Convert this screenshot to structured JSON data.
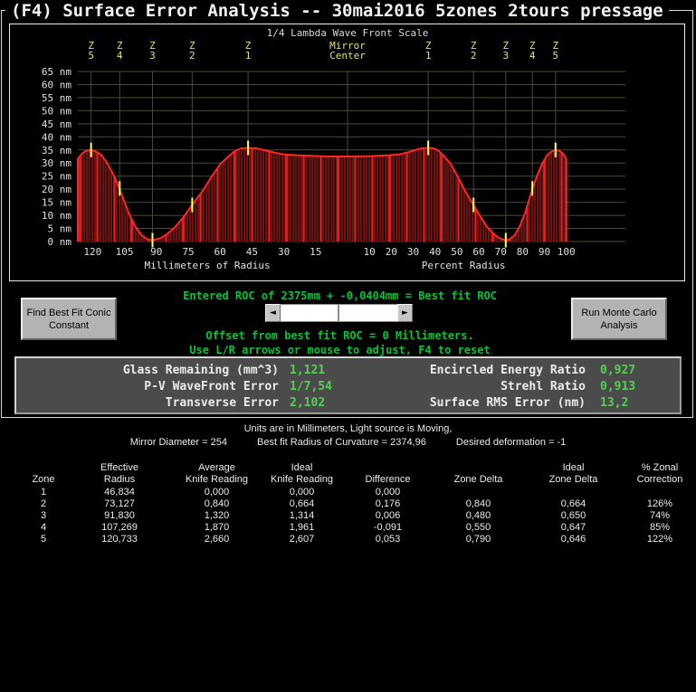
{
  "window": {
    "title": "(F4) Surface Error Analysis -- 30mai2016  5zones 2tours pressage"
  },
  "colors": {
    "accent_green": "#00c838",
    "value_green": "#55d055",
    "zone_yellow": "#e4e45c",
    "curve_red": "#ff2626",
    "hatch_red": "#b01212",
    "grid_olive": "#4a4a39"
  },
  "chart_data": {
    "type": "area",
    "title": "1/4 Lambda Wave Front Scale",
    "y_unit": "nm",
    "ylim": [
      0,
      65
    ],
    "y_ticks": [
      0,
      5,
      10,
      15,
      20,
      25,
      30,
      35,
      40,
      45,
      50,
      55,
      60,
      65
    ],
    "x_left": {
      "label": "Millimeters of Radius",
      "ticks": [
        120,
        105,
        90,
        75,
        60,
        45,
        30,
        15
      ]
    },
    "x_right": {
      "label": "Percent Radius",
      "ticks": [
        10,
        20,
        30,
        40,
        50,
        60,
        70,
        80,
        90,
        100
      ]
    },
    "mirror_radius_mm": 127,
    "center_label": [
      "Mirror",
      "Center"
    ],
    "zones": {
      "numbers": [
        1,
        2,
        3,
        4,
        5
      ],
      "radii_mm": [
        46.834,
        73.127,
        91.83,
        107.269,
        120.733
      ],
      "marker_nm": [
        35.8,
        14,
        0.5,
        20.3,
        35
      ]
    },
    "profile_mm_nm": [
      [
        0,
        32.5
      ],
      [
        8,
        32.5
      ],
      [
        16,
        32.7
      ],
      [
        24,
        33.0
      ],
      [
        30,
        33.3
      ],
      [
        35,
        34.1
      ],
      [
        40,
        35.1
      ],
      [
        43,
        35.6
      ],
      [
        46.8,
        35.8
      ],
      [
        50,
        35.6
      ],
      [
        53,
        34.6
      ],
      [
        56,
        32.6
      ],
      [
        60,
        29.5
      ],
      [
        64,
        24.8
      ],
      [
        68,
        19.6
      ],
      [
        73.1,
        14.0
      ],
      [
        77,
        9.6
      ],
      [
        81,
        5.6
      ],
      [
        85,
        2.8
      ],
      [
        88,
        1.3
      ],
      [
        91.8,
        0.4
      ],
      [
        94,
        0.8
      ],
      [
        97,
        2.4
      ],
      [
        100,
        5.8
      ],
      [
        103,
        10.8
      ],
      [
        107.3,
        20.0
      ],
      [
        110,
        25.2
      ],
      [
        113,
        29.8
      ],
      [
        116,
        33.2
      ],
      [
        118.5,
        34.4
      ],
      [
        120.7,
        35.0
      ],
      [
        123,
        34.7
      ],
      [
        125,
        33.6
      ],
      [
        127,
        31.6
      ]
    ]
  },
  "controls": {
    "roc_line": "Entered ROC of 2375mm + -0,0404mm = Best fit ROC",
    "offset_line": "Offset from best fit ROC = 0 Millimeters.",
    "hint_line": "Use L/R arrows or mouse to adjust, F4 to reset",
    "find_conic_button": "Find Best Fit Conic Constant",
    "monte_carlo_button": "Run Monte Carlo Analysis",
    "scrollbar_left_arrow": "◄",
    "scrollbar_right_arrow": "►"
  },
  "stats": {
    "left": [
      {
        "label": "Glass Remaining (mm^3)",
        "value": "1,121"
      },
      {
        "label": "P-V WaveFront Error",
        "value": "1/7,54"
      },
      {
        "label": "Transverse Error",
        "value": "2,102"
      }
    ],
    "right": [
      {
        "label": "Encircled Energy Ratio",
        "value": "0,927"
      },
      {
        "label": "Strehl Ratio",
        "value": "0,913"
      },
      {
        "label": "Surface RMS Error (nm)",
        "value": "13,2"
      }
    ]
  },
  "info": {
    "line1": "Units are in Millimeters, Light source is Moving,",
    "parts": [
      "Mirror Diameter = 254",
      "Best fit Radius of Curvature = 2374,96",
      "Desired deformation = -1"
    ]
  },
  "table": {
    "headers": [
      {
        "l1": "",
        "l2": "Zone"
      },
      {
        "l1": "Effective",
        "l2": "Radius"
      },
      {
        "l1": "Average",
        "l2": "Knife Reading"
      },
      {
        "l1": "Ideal",
        "l2": "Knife Reading"
      },
      {
        "l1": "",
        "l2": "Difference"
      },
      {
        "l1": "",
        "l2": "Zone Delta"
      },
      {
        "l1": "Ideal",
        "l2": "Zone Delta"
      },
      {
        "l1": "% Zonal",
        "l2": "Correction"
      }
    ],
    "rows": [
      [
        "1",
        "46,834",
        "0,000",
        "0,000",
        "0,000",
        "",
        "",
        ""
      ],
      [
        "2",
        "73,127",
        "0,840",
        "0,664",
        "0,176",
        "0,840",
        "0,664",
        "126%"
      ],
      [
        "3",
        "91,830",
        "1,320",
        "1,314",
        "0,006",
        "0,480",
        "0,650",
        "74%"
      ],
      [
        "4",
        "107,269",
        "1,870",
        "1,961",
        "-0,091",
        "0,550",
        "0,647",
        "85%"
      ],
      [
        "5",
        "120,733",
        "2,660",
        "2,607",
        "0,053",
        "0,790",
        "0,646",
        "122%"
      ]
    ]
  }
}
